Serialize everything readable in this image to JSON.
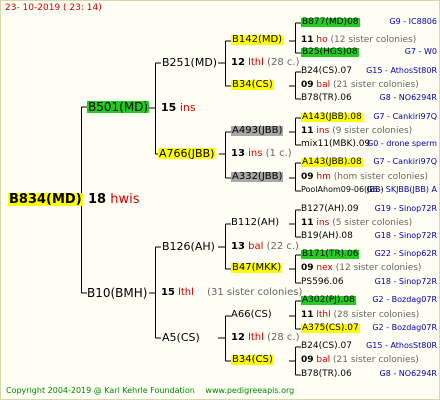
{
  "header": {
    "date": "23- 10-2019 ( 23: 14)"
  },
  "footer": {
    "copyright": "Copyright 2004-2019 @ Karl Kehrle Foundation",
    "site": "www.pedigreeapis.org"
  },
  "root": {
    "id": "B834(MD)",
    "num": "18",
    "unit": "hwis"
  },
  "g1": [
    {
      "id": "B501(MD)",
      "num": "15",
      "unit": "ins"
    },
    {
      "id": "B10(BMH)",
      "num": "15",
      "unit": "lthl",
      "note": "(31 sister colonies)"
    }
  ],
  "g2": [
    {
      "id": "B251(MD)",
      "num": "12",
      "unit": "lthl",
      "note": "(28 c.)"
    },
    {
      "id": "A766(JBB)",
      "num": "13",
      "unit": "ins",
      "note": "(1 c.)"
    },
    {
      "id": "B126(AH)",
      "num": "13",
      "unit": "bal",
      "note": "(22 c.)"
    },
    {
      "id": "A5(CS)",
      "num": "12",
      "unit": "lthl",
      "note": "(28 c.)"
    }
  ],
  "g3": [
    {
      "id": "B142(MD)",
      "num": "11",
      "unit": "ho",
      "note": "(12 sister colonies)"
    },
    {
      "id": "B34(CS)",
      "num": "09",
      "unit": "bal",
      "note": "(21 sister colonies)"
    },
    {
      "id": "A493(JBB)",
      "num": "11",
      "unit": "ins",
      "note": "(9 sister colonies)"
    },
    {
      "id": "A332(JBB)",
      "num": "09",
      "unit": "hm",
      "note": "(hom sister colonies)"
    },
    {
      "id": "B112(AH)",
      "num": "11",
      "unit": "ins",
      "note": "(5 sister colonies)"
    },
    {
      "id": "B47(MKK)",
      "num": "09",
      "unit": "nex",
      "note": "(12 sister colonies)"
    },
    {
      "id": "A66(CS)",
      "num": "11",
      "unit": "lthl",
      "note": "(28 sister colonies)"
    },
    {
      "id": "B34(CS)",
      "num": "09",
      "unit": "bal",
      "note": "(21 sister colonies)"
    }
  ],
  "g4": [
    {
      "id": "B877(MD)08",
      "place": "G9 - IC8806"
    },
    {
      "id": "B25(HGS)08",
      "place": "G7 - W0"
    },
    {
      "id": "B24(CS).07",
      "place": "G15 - AthosSt80R"
    },
    {
      "id": "B78(TR).06",
      "place": "G8 - NO6294R"
    },
    {
      "id": "A143(JBB).08",
      "place": "G7 - Cankiri97Q"
    },
    {
      "id": "mix11(MBK).09",
      "place": "G0 - drone sperm"
    },
    {
      "id": "A143(JBB).08",
      "place": "G7 - Cankiri97Q"
    },
    {
      "id": "PoolAhom09-06(JBB)",
      "place": "G6 - SKJBB(JBB) A"
    },
    {
      "id": "B127(AH).09",
      "place": "G19 - Sinop72R"
    },
    {
      "id": "B19(AH).08",
      "place": "G18 - Sinop72R"
    },
    {
      "id": "B171(TR).06",
      "place": "G22 - Sinop62R"
    },
    {
      "id": "PS596.06",
      "place": "G18 - Sinop72R"
    },
    {
      "id": "A302(PJ).08",
      "place": "G2 - Bozdag07R"
    },
    {
      "id": "A375(CS).07",
      "place": "G2 - Bozdag07R"
    },
    {
      "id": "B24(CS).07",
      "place": "G15 - AthosSt80R"
    },
    {
      "id": "B78(TR).06",
      "place": "G8 - NO6294R"
    }
  ],
  "colors": {
    "queen_yellow": "#ffff00",
    "queen_green": "#22cc22",
    "queen_grey": "#a8a8a8",
    "lines": "#000000",
    "red": "#cc0000",
    "blue": "#0000b0",
    "footer_green": "#008800"
  }
}
